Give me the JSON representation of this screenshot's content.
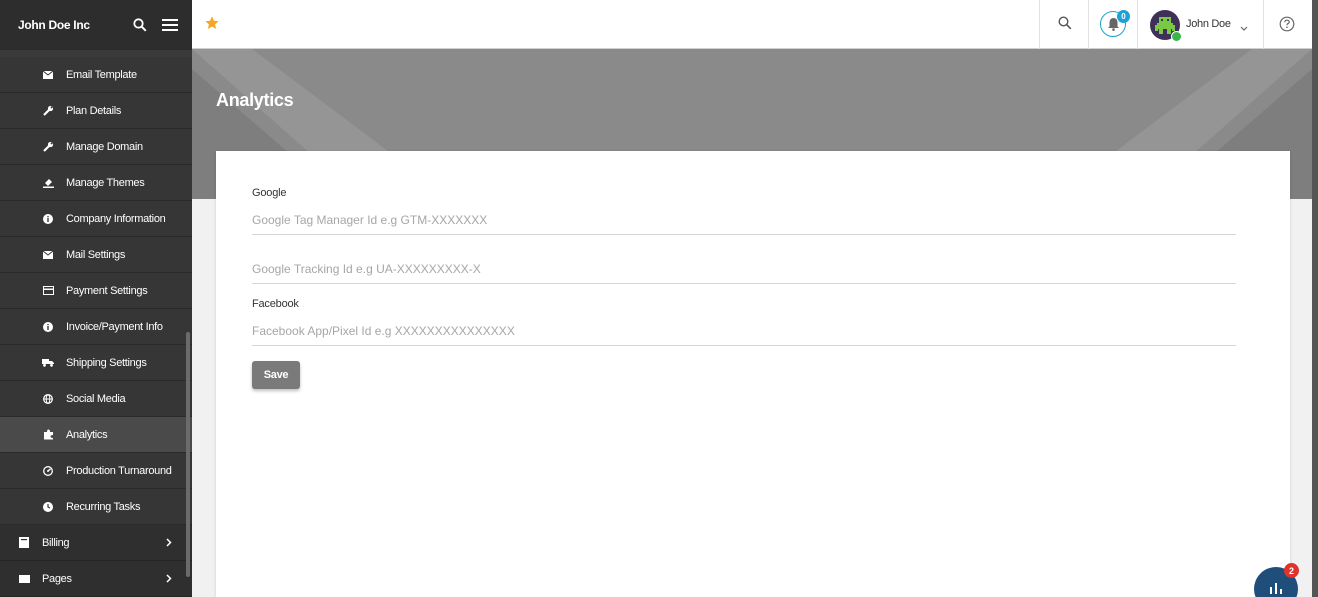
{
  "sidebar": {
    "brand": "John Doe Inc",
    "items": [
      {
        "label": "Email Template",
        "icon": "envelope-icon"
      },
      {
        "label": "Plan Details",
        "icon": "wrench-icon"
      },
      {
        "label": "Manage Domain",
        "icon": "wrench-icon"
      },
      {
        "label": "Manage Themes",
        "icon": "paint-icon"
      },
      {
        "label": "Company Information",
        "icon": "info-icon"
      },
      {
        "label": "Mail Settings",
        "icon": "envelope-icon"
      },
      {
        "label": "Payment Settings",
        "icon": "card-icon"
      },
      {
        "label": "Invoice/Payment Info",
        "icon": "info-icon"
      },
      {
        "label": "Shipping Settings",
        "icon": "truck-icon"
      },
      {
        "label": "Social Media",
        "icon": "globe-icon"
      },
      {
        "label": "Analytics",
        "icon": "puzzle-icon"
      },
      {
        "label": "Production Turnaround",
        "icon": "gauge-icon"
      },
      {
        "label": "Recurring Tasks",
        "icon": "clock-icon"
      }
    ],
    "top_items": [
      {
        "label": "Billing",
        "icon": "billing-icon"
      },
      {
        "label": "Pages",
        "icon": "pages-icon"
      }
    ]
  },
  "header": {
    "notification_count": "0",
    "user_name": "John Doe"
  },
  "page": {
    "title": "Analytics"
  },
  "form": {
    "google_label": "Google",
    "gtm_placeholder": "Google Tag Manager Id e.g GTM-XXXXXXX",
    "ua_placeholder": "Google Tracking Id e.g UA-XXXXXXXXX-X",
    "facebook_label": "Facebook",
    "fb_placeholder": "Facebook App/Pixel Id e.g XXXXXXXXXXXXXXX",
    "save_label": "Save"
  },
  "chat": {
    "badge_count": "2"
  },
  "colors": {
    "sidebar_bg": "#3a3a3a",
    "banner_bg": "#8a8a8a",
    "accent": "#1aa3d8",
    "star": "#f5a623",
    "save_bg": "#7a7a7a"
  }
}
